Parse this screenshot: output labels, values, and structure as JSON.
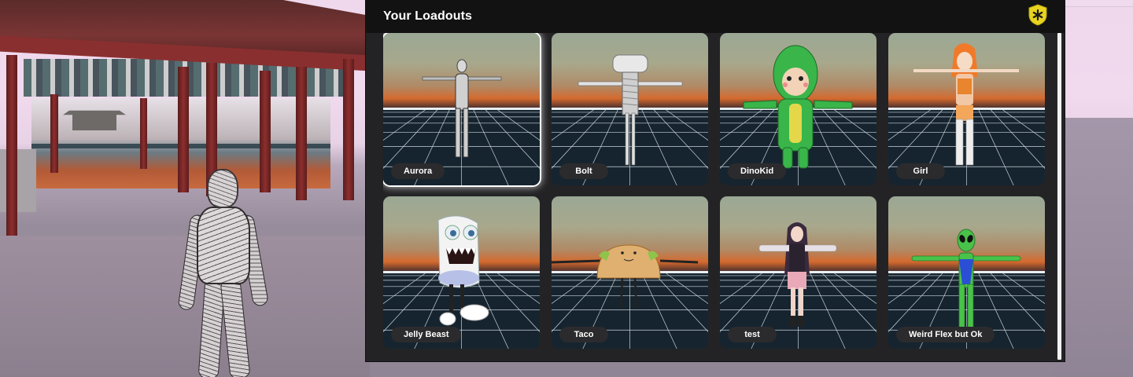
{
  "panel": {
    "title": "Your Loadouts",
    "badge_icon": "shield-badge-icon",
    "colors": {
      "header_bg": "#121212",
      "panel_bg": "#232325",
      "label_bg": "#2b2b2d",
      "badge_yellow": "#e8d320",
      "selected_glow": "#ffffff"
    }
  },
  "loadouts": [
    {
      "name": "Aurora",
      "selected": true
    },
    {
      "name": "Bolt",
      "selected": false
    },
    {
      "name": "DinoKid",
      "selected": false
    },
    {
      "name": "Girl",
      "selected": false
    },
    {
      "name": "Jelly Beast",
      "selected": false
    },
    {
      "name": "Taco",
      "selected": false
    },
    {
      "name": "test",
      "selected": false
    },
    {
      "name": "Weird Flex but Ok",
      "selected": false
    }
  ]
}
